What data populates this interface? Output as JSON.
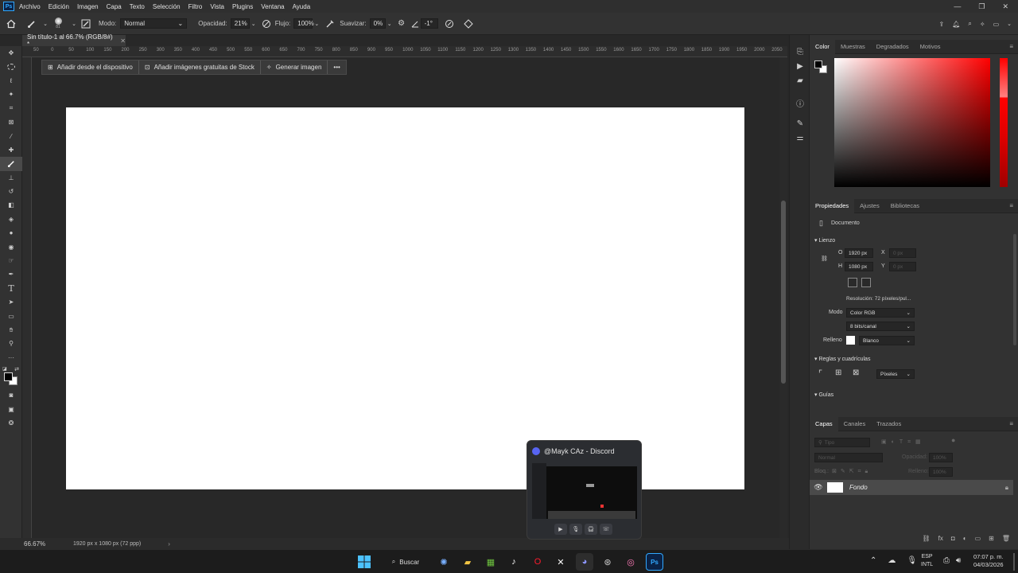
{
  "app": {
    "logo": "Ps"
  },
  "menu": [
    "Archivo",
    "Edición",
    "Imagen",
    "Capa",
    "Texto",
    "Selección",
    "Filtro",
    "Vista",
    "Plugins",
    "Ventana",
    "Ayuda"
  ],
  "options": {
    "brush_size": "81",
    "mode_label": "Modo:",
    "mode_value": "Normal",
    "opacity_label": "Opacidad:",
    "opacity_value": "21%",
    "flow_label": "Flujo:",
    "flow_value": "100%",
    "smooth_label": "Suavizar:",
    "smooth_value": "0%",
    "angle_value": "-1°"
  },
  "document": {
    "tab_title": "Sin título-1 al 66.7% (RGB/8#) *"
  },
  "ruler_ticks": [
    "50",
    "0",
    "50",
    "100",
    "150",
    "200",
    "250",
    "300",
    "350",
    "400",
    "450",
    "500",
    "550",
    "600",
    "650",
    "700",
    "750",
    "800",
    "850",
    "900",
    "950",
    "1000",
    "1050",
    "1100",
    "1150",
    "1200",
    "1250",
    "1300",
    "1350",
    "1400",
    "1450",
    "1500",
    "1550",
    "1600",
    "1650",
    "1700",
    "1750",
    "1800",
    "1850",
    "1900",
    "1950",
    "2000",
    "2050"
  ],
  "context_bar": {
    "add_device": "Añadir desde el dispositivo",
    "add_stock": "Añadir imágenes gratuitas de Stock",
    "generate": "Generar imagen",
    "more": "•••"
  },
  "status": {
    "zoom": "66.67%",
    "doc_info": "1920 px x 1080 px (72 ppp)"
  },
  "color_panel": {
    "tabs": [
      "Color",
      "Muestras",
      "Degradados",
      "Motivos"
    ],
    "hue": "#ff0000"
  },
  "properties": {
    "tabs": [
      "Propiedades",
      "Ajustes",
      "Bibliotecas"
    ],
    "doc_label": "Documento",
    "canvas_title": "Lienzo",
    "w_label": "O",
    "w_value": "1920 px",
    "h_label": "H",
    "h_value": "1080 px",
    "x_label": "X",
    "x_value": "0 px",
    "y_label": "Y",
    "y_value": "0 px",
    "resolution": "Resolución: 72 píxeles/pul...",
    "mode_label": "Modo",
    "mode_value": "Color RGB",
    "bits_value": "8 bits/canal",
    "fill_label": "Relleno",
    "fill_value": "Blanco",
    "rulers_title": "Reglas y cuadrículas",
    "units_value": "Píxeles",
    "guides_title": "Guías"
  },
  "layers": {
    "tabs": [
      "Capas",
      "Canales",
      "Trazados"
    ],
    "search_placeholder": "Tipo",
    "blend": "Normal",
    "opacity_label": "Opacidad:",
    "opacity_value": "100%",
    "lock_label": "Bloq.:",
    "fill_label": "Relleno:",
    "fill_value": "100%",
    "layer_name": "Fondo"
  },
  "discord_popup": {
    "title": "@Mayk CAz - Discord"
  },
  "taskbar": {
    "search": "Buscar",
    "lang_top": "ESP",
    "lang_bottom": "INTL",
    "time": "07:07 p. m.",
    "date": "04/03/2026"
  }
}
